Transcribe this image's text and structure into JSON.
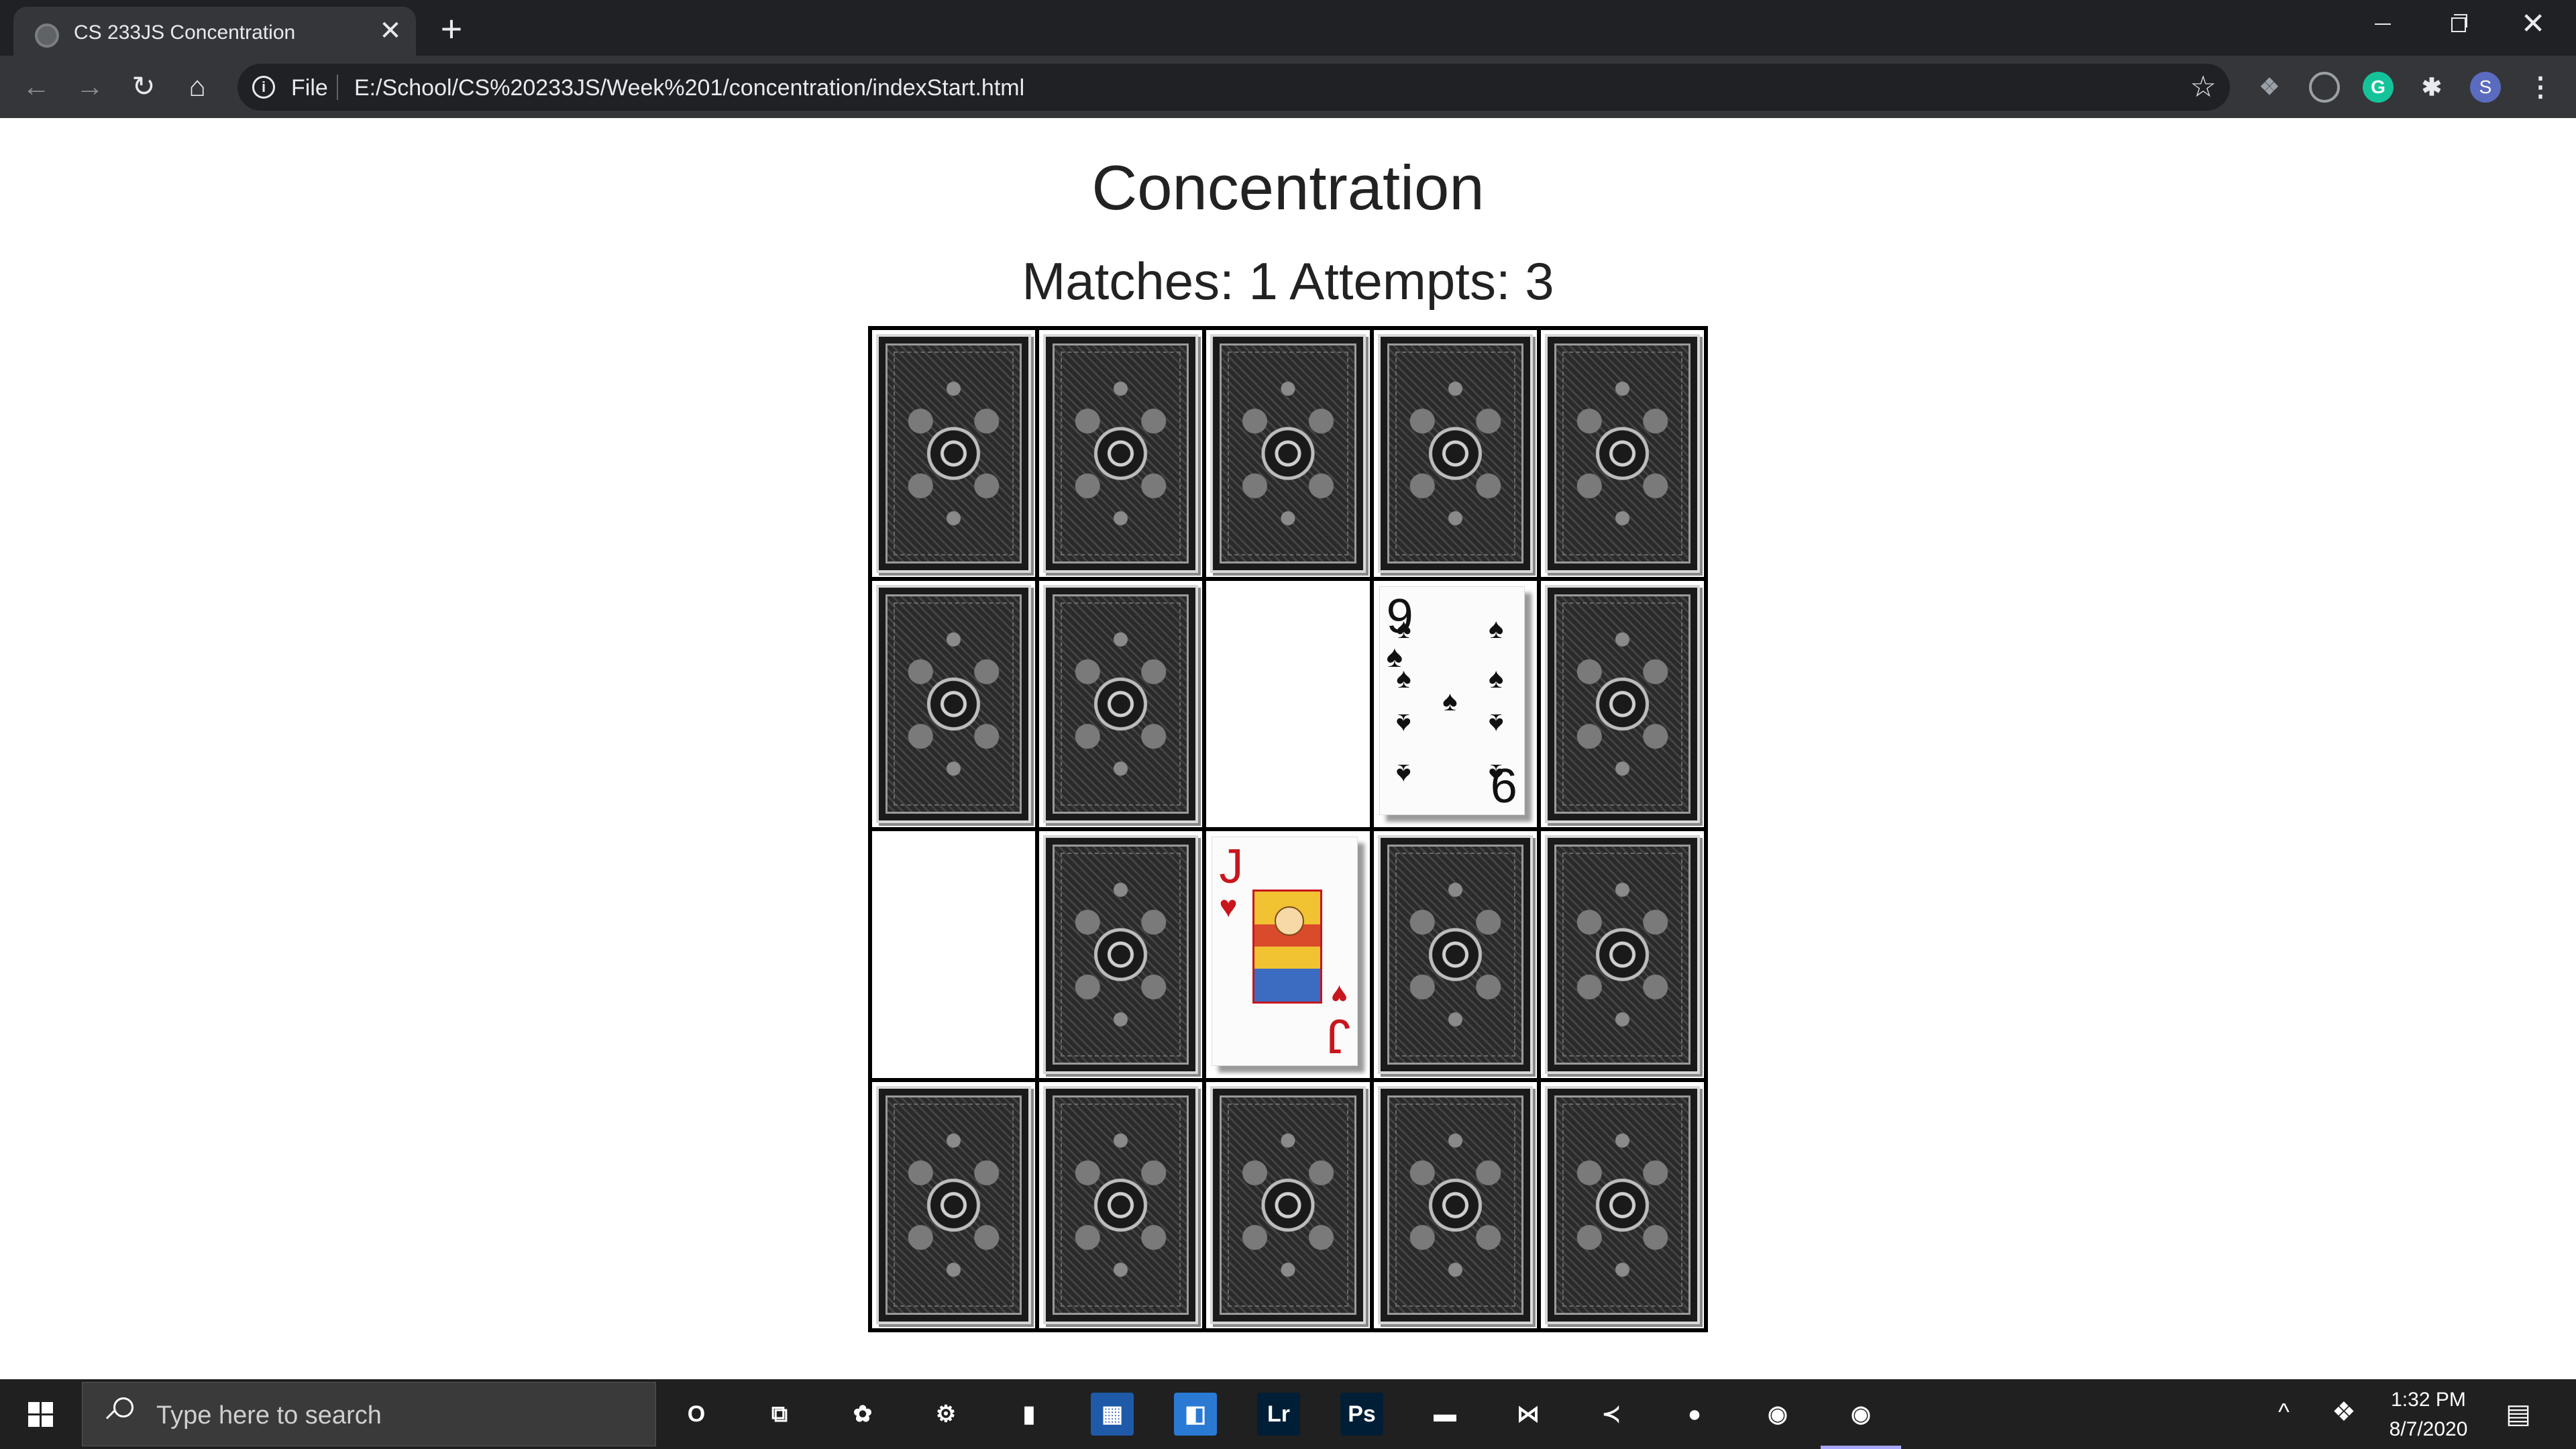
{
  "browser": {
    "tab_title": "CS 233JS Concentration",
    "tab_close": "✕",
    "new_tab": "+",
    "window_close": "✕",
    "nav": {
      "back": "←",
      "forward": "→",
      "reload": "↻",
      "home": "⌂"
    },
    "info_icon": "i",
    "scheme_label": "File",
    "url": "E:/School/CS%20233JS/Week%201/concentration/indexStart.html",
    "star_icon": "☆",
    "extensions": {
      "dropbox": "❖",
      "grammarly": "G",
      "puzzle": "✱",
      "profile": "S",
      "menu": "⋮"
    }
  },
  "page": {
    "title": "Concentration",
    "stats": "Matches: 1 Attempts: 3"
  },
  "board": {
    "rows": 4,
    "cols": 5,
    "cells": [
      {
        "state": "back"
      },
      {
        "state": "back"
      },
      {
        "state": "back"
      },
      {
        "state": "back"
      },
      {
        "state": "back"
      },
      {
        "state": "back"
      },
      {
        "state": "back"
      },
      {
        "state": "matched"
      },
      {
        "state": "face",
        "rank": "9",
        "suit": "♠",
        "color": "black"
      },
      {
        "state": "back"
      },
      {
        "state": "matched"
      },
      {
        "state": "back"
      },
      {
        "state": "face",
        "rank": "J",
        "suit": "♥",
        "color": "red"
      },
      {
        "state": "back"
      },
      {
        "state": "back"
      },
      {
        "state": "back"
      },
      {
        "state": "back"
      },
      {
        "state": "back"
      },
      {
        "state": "back"
      },
      {
        "state": "back"
      }
    ]
  },
  "taskbar": {
    "search_placeholder": "Type here to search",
    "apps": [
      {
        "name": "cortana-icon",
        "glyph": "O",
        "bg": "transparent"
      },
      {
        "name": "task-view-icon",
        "glyph": "⧉",
        "bg": "transparent"
      },
      {
        "name": "pinned-app-1-icon",
        "glyph": "✿",
        "bg": "transparent"
      },
      {
        "name": "settings-app-icon",
        "glyph": "⚙",
        "bg": "transparent"
      },
      {
        "name": "pinned-app-3-icon",
        "glyph": "▮",
        "bg": "transparent"
      },
      {
        "name": "media-app-icon",
        "glyph": "▦",
        "bg": "#1e5aa8"
      },
      {
        "name": "store-app-icon",
        "glyph": "◧",
        "bg": "#2a7ad4"
      },
      {
        "name": "lightroom-icon",
        "glyph": "Lr",
        "bg": "#001e36"
      },
      {
        "name": "photoshop-icon",
        "glyph": "Ps",
        "bg": "#001e36"
      },
      {
        "name": "file-explorer-icon",
        "glyph": "▬",
        "bg": "transparent"
      },
      {
        "name": "visual-studio-icon",
        "glyph": "⋈",
        "bg": "transparent"
      },
      {
        "name": "vscode-icon",
        "glyph": "≺",
        "bg": "transparent"
      },
      {
        "name": "firefox-icon",
        "glyph": "●",
        "bg": "transparent"
      },
      {
        "name": "chrome-icon",
        "glyph": "◉",
        "bg": "transparent"
      },
      {
        "name": "chrome-active-icon",
        "glyph": "◉",
        "bg": "transparent"
      }
    ],
    "tray_chevron": "^",
    "tray_dropbox": "❖",
    "time": "1:32 PM",
    "date": "8/7/2020",
    "notification_icon": "▤"
  }
}
